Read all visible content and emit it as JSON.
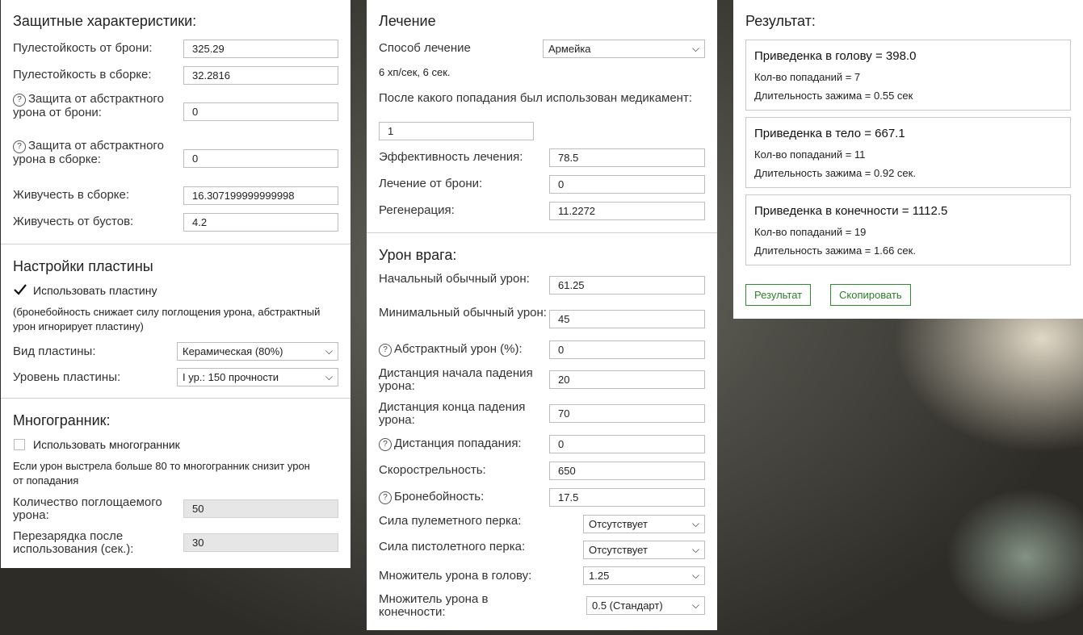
{
  "protection": {
    "title": "Защитные характеристики:",
    "fields": [
      {
        "label": "Пулестойкость от брони:",
        "value": "325.29",
        "help": false
      },
      {
        "label": "Пулестойкость в сборке:",
        "value": "32.2816",
        "help": false
      },
      {
        "label": "Защита от абстрактного урона от брони:",
        "value": "0",
        "help": true
      },
      {
        "label": "Защита от абстрактного урона в сборке:",
        "value": "0",
        "help": true
      },
      {
        "label": "Живучесть в сборке:",
        "value": "16.307199999999998",
        "help": false
      },
      {
        "label": "Живучесть от бустов:",
        "value": "4.2",
        "help": false
      }
    ]
  },
  "plate": {
    "title": "Настройки пластины",
    "use_label": "Использовать пластину",
    "use_checked": true,
    "note": "(бронебойность снижает силу поглощения урона, абстрактный урон игнорирует пластину)",
    "type_label": "Вид пластины:",
    "type_value": "Керамическая (80%)",
    "level_label": "Уровень пластины:",
    "level_value": "I ур.: 150 прочности"
  },
  "polyhedron": {
    "title": "Многогранник:",
    "use_label": "Использовать многогранник",
    "use_checked": false,
    "note": "Если урон выстрела больше 80 то многогранник снизит урон от попадания",
    "absorb_label": "Количество поглощаемого урона:",
    "absorb_value": "50",
    "reload_label": "Перезарядка после использования (сек.):",
    "reload_value": "30"
  },
  "healing": {
    "title": "Лечение",
    "method_label": "Способ лечение",
    "method_value": "Армейка",
    "rate_text": "6 хп/сек, 6 сек.",
    "after_hit_label": "После какого попадания был использован медикамент:",
    "after_hit_value": "1",
    "efficiency_label": "Эффективность лечения:",
    "efficiency_value": "78.5",
    "armor_heal_label": "Лечение от брони:",
    "armor_heal_value": "0",
    "regen_label": "Регенерация:",
    "regen_value": "11.2272"
  },
  "enemy": {
    "title": "Урон врага:",
    "fields": [
      {
        "label": "Начальный обычный урон:",
        "value": "61.25",
        "help": false
      },
      {
        "label": "Минимальный обычный урон:",
        "value": "45",
        "help": false
      },
      {
        "label": "Абстрактный урон (%):",
        "value": "0",
        "help": true
      },
      {
        "label": "Дистанция начала падения урона:",
        "value": "20",
        "help": false
      },
      {
        "label": "Дистанция конца падения урона:",
        "value": "70",
        "help": false
      },
      {
        "label": "Дистанция попадания:",
        "value": "0",
        "help": true
      },
      {
        "label": "Скорострельность:",
        "value": "650",
        "help": false
      },
      {
        "label": "Бронебойность:",
        "value": "17.5",
        "help": true
      }
    ],
    "mg_perk_label": "Сила пулеметного перка:",
    "mg_perk_value": "Отсутствует",
    "pistol_perk_label": "Сила пистолетного перка:",
    "pistol_perk_value": "Отсутствует",
    "head_mult_label": "Множитель урона в голову:",
    "head_mult_value": "1.25",
    "limb_mult_label": "Множитель урона в конечности:",
    "limb_mult_value": "0.5 (Стандарт)"
  },
  "result": {
    "title": "Результат:",
    "boxes": [
      {
        "title": "Приведенка в голову = 398.0",
        "hits": "Кол-во попаданий = 7",
        "hold": "Длительность зажима = 0.55 сек"
      },
      {
        "title": "Приведенка в тело = 667.1",
        "hits": "Кол-во попаданий = 11",
        "hold": "Длительность зажима = 0.92 сек."
      },
      {
        "title": "Приведенка в конечности = 1112.5",
        "hits": "Кол-во попаданий = 19",
        "hold": "Длительность зажима = 1.66 сек."
      }
    ],
    "result_button": "Результат",
    "copy_button": "Скопировать"
  },
  "icons": {
    "help": "question-circle-icon",
    "dropdown": "chevron-down-icon",
    "check": "checkmark-icon"
  },
  "colors": {
    "button_green": "#2e7d2e",
    "panel_bg": "#ffffff"
  }
}
